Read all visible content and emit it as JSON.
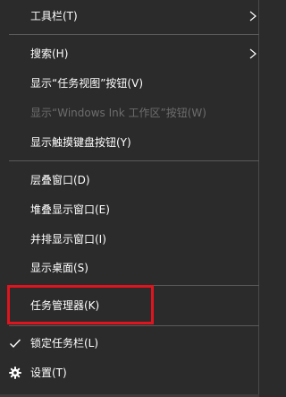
{
  "menu": {
    "toolbars": "工具栏(T)",
    "search": "搜索(H)",
    "show_task_view": "显示“任务视图”按钮(V)",
    "show_windows_ink": "显示“Windows Ink 工作区”按钮(W)",
    "show_touch_keyboard": "显示触摸键盘按钮(Y)",
    "cascade_windows": "层叠窗口(D)",
    "stack_windows": "堆叠显示窗口(E)",
    "side_by_side": "并排显示窗口(I)",
    "show_desktop": "显示桌面(S)",
    "task_manager": "任务管理器(K)",
    "lock_taskbar": "锁定任务栏(L)",
    "settings": "设置(T)"
  },
  "colors": {
    "menu_background": "#2b2b2b",
    "text": "#ffffff",
    "disabled_text": "#6d6d6d",
    "separator": "#5a5a5a",
    "highlight_border": "#e0141e"
  },
  "icons": {
    "submenu_arrow": "chevron-right-icon",
    "checked": "checkmark-icon",
    "settings": "gear-icon"
  }
}
